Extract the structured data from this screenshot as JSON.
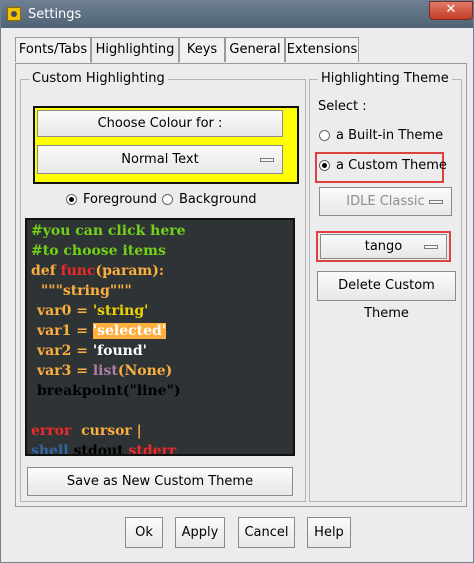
{
  "window": {
    "title": "Settings",
    "close_glyph": "✕"
  },
  "tabs": [
    {
      "label": "Fonts/Tabs",
      "active": false
    },
    {
      "label": "Highlighting",
      "active": true
    },
    {
      "label": "Keys",
      "active": false
    },
    {
      "label": "General",
      "active": false
    },
    {
      "label": "Extensions",
      "active": false
    }
  ],
  "custom_highlighting": {
    "group_title": "Custom Highlighting",
    "choose_colour_label": "Choose Colour for :",
    "element_selected": "Normal Text",
    "foreground_label": "Foreground",
    "background_label": "Background",
    "selected_radio": "Foreground",
    "save_theme_label": "Save as New Custom Theme"
  },
  "sample": {
    "line1": "#you can click here",
    "line2": "#to choose items",
    "line3_def": "def ",
    "line3_func": "func",
    "line3_rest": "(param):",
    "line4": "\"\"\"string\"\"\"",
    "line5_a": "var0 = ",
    "line5_b": "'string'",
    "line6_a": "var1 = ",
    "line6_b": "'selected'",
    "line7_a": "var2 = ",
    "line7_b": "'found'",
    "line8_a": "var3 = ",
    "line8_b": "list",
    "line8_c": "(",
    "line8_d": "None",
    "line8_e": ")",
    "line9": "breakpoint(\"line\")",
    "line10_a": "error",
    "line10_b": "  cursor |",
    "line11_a": "shell",
    "line11_b": " stdout",
    "line11_c": " stderr"
  },
  "highlighting_theme": {
    "group_title": "Highlighting Theme",
    "select_label": "Select :",
    "builtin_label": "a Built-in Theme",
    "custom_label": "a Custom Theme",
    "selected": "a Custom Theme",
    "builtin_value": "IDLE Classic",
    "custom_value": "tango",
    "delete_label": "Delete Custom Theme"
  },
  "footer": {
    "ok": "Ok",
    "apply": "Apply",
    "cancel": "Cancel",
    "help": "Help"
  },
  "colors": {
    "yellow_frame": "#ffff00",
    "highlight_red": "#e0403e",
    "code_bg": "#2e3436",
    "comment": "#73d216",
    "keyword": "#fcaf3e",
    "def_name": "#ef2929",
    "string": "#edd400",
    "builtin": "#ad7fa8",
    "selected_bg": "#fcaf3e"
  }
}
